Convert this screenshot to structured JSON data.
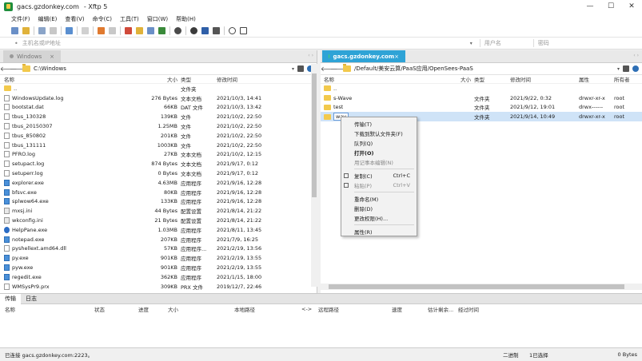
{
  "app": {
    "host": "gacs.gzdonkey.com",
    "title_suffix": "- Xftp 5"
  },
  "window_controls": {
    "minimize": "—",
    "maximize": "☐",
    "close": "✕"
  },
  "menu": [
    "文件(F)",
    "编辑(E)",
    "查看(V)",
    "命令(C)",
    "工具(T)",
    "窗口(W)",
    "帮助(H)"
  ],
  "addressbar": {
    "host_placeholder": "主机名或IP地址",
    "user_placeholder": "用户名",
    "password_placeholder": "密码"
  },
  "left": {
    "tab": "Windows",
    "path": "C:\\Windows",
    "columns": [
      "名称",
      "大小",
      "类型",
      "修改时间"
    ],
    "files": [
      {
        "name": "..",
        "size": "",
        "type": "文件夹",
        "mtime": "",
        "icon": "folder"
      },
      {
        "name": "WindowsUpdate.log",
        "size": "276 Bytes",
        "type": "文本文档",
        "mtime": "2021/10/3, 14:41",
        "icon": "file"
      },
      {
        "name": "bootstat.dat",
        "size": "66KB",
        "type": "DAT 文件",
        "mtime": "2021/10/3, 13:42",
        "icon": "file"
      },
      {
        "name": "tbus_130328",
        "size": "139KB",
        "type": "文件",
        "mtime": "2021/10/2, 22:50",
        "icon": "file"
      },
      {
        "name": "tbus_20150307",
        "size": "1.25MB",
        "type": "文件",
        "mtime": "2021/10/2, 22:50",
        "icon": "file"
      },
      {
        "name": "tbus_850802",
        "size": "201KB",
        "type": "文件",
        "mtime": "2021/10/2, 22:50",
        "icon": "file"
      },
      {
        "name": "tbus_131111",
        "size": "1003KB",
        "type": "文件",
        "mtime": "2021/10/2, 22:50",
        "icon": "file"
      },
      {
        "name": "PFRO.log",
        "size": "27KB",
        "type": "文本文档",
        "mtime": "2021/10/2, 12:15",
        "icon": "file"
      },
      {
        "name": "setupact.log",
        "size": "874 Bytes",
        "type": "文本文档",
        "mtime": "2021/9/17, 0:12",
        "icon": "file"
      },
      {
        "name": "setuperr.log",
        "size": "0 Bytes",
        "type": "文本文档",
        "mtime": "2021/9/17, 0:12",
        "icon": "file"
      },
      {
        "name": "explorer.exe",
        "size": "4.63MB",
        "type": "应用程序",
        "mtime": "2021/9/16, 12:28",
        "icon": "exe"
      },
      {
        "name": "bfsvc.exe",
        "size": "80KB",
        "type": "应用程序",
        "mtime": "2021/9/16, 12:28",
        "icon": "exe"
      },
      {
        "name": "splwow64.exe",
        "size": "133KB",
        "type": "应用程序",
        "mtime": "2021/9/16, 12:28",
        "icon": "exe"
      },
      {
        "name": "mxsj.ini",
        "size": "44 Bytes",
        "type": "配置设置",
        "mtime": "2021/8/14, 21:22",
        "icon": "cfg"
      },
      {
        "name": "wkconfig.ini",
        "size": "21 Bytes",
        "type": "配置设置",
        "mtime": "2021/8/14, 21:22",
        "icon": "cfg"
      },
      {
        "name": "HelpPane.exe",
        "size": "1.03MB",
        "type": "应用程序",
        "mtime": "2021/8/11, 13:45",
        "icon": "help"
      },
      {
        "name": "notepad.exe",
        "size": "207KB",
        "type": "应用程序",
        "mtime": "2021/7/9, 16:25",
        "icon": "exe"
      },
      {
        "name": "pyshellext.amd64.dll",
        "size": "57KB",
        "type": "应用程序...",
        "mtime": "2021/2/19, 13:56",
        "icon": "file"
      },
      {
        "name": "py.exe",
        "size": "901KB",
        "type": "应用程序",
        "mtime": "2021/2/19, 13:55",
        "icon": "exe"
      },
      {
        "name": "pyw.exe",
        "size": "901KB",
        "type": "应用程序",
        "mtime": "2021/2/19, 13:55",
        "icon": "exe"
      },
      {
        "name": "regedit.exe",
        "size": "362KB",
        "type": "应用程序",
        "mtime": "2021/1/15, 18:00",
        "icon": "exe"
      },
      {
        "name": "WMSysPr9.prx",
        "size": "309KB",
        "type": "PRX 文件",
        "mtime": "2019/12/7, 22:46",
        "icon": "file"
      }
    ]
  },
  "right": {
    "tab": "gacs.gzdonkey.com",
    "path": "/Default/美安云算/PaaS应用/OpenSees-PaaS",
    "columns": [
      "名称",
      "大小",
      "类型",
      "修改时间",
      "属性",
      "所有者"
    ],
    "files": [
      {
        "name": "..",
        "size": "",
        "type": "",
        "mtime": "",
        "attr": "",
        "owner": ""
      },
      {
        "name": "s-Wave",
        "size": "",
        "type": "文件夹",
        "mtime": "2021/9/22, 0:32",
        "attr": "drwxr-xr-x",
        "owner": "root"
      },
      {
        "name": "test",
        "size": "",
        "type": "文件夹",
        "mtime": "2021/9/12, 19:01",
        "attr": "drwx------",
        "owner": "root"
      },
      {
        "name": "wav",
        "size": "",
        "type": "文件夹",
        "mtime": "2021/9/14, 10:49",
        "attr": "drwxr-xr-x",
        "owner": "root"
      }
    ]
  },
  "context_menu": [
    {
      "label": "传输(T)",
      "shortcut": "",
      "disabled": false,
      "bold": false
    },
    {
      "label": "下载到默认文件夹(F)",
      "shortcut": "",
      "disabled": false,
      "bold": false
    },
    {
      "label": "队列(Q)",
      "shortcut": "",
      "disabled": false,
      "bold": false
    },
    {
      "label": "打开(O)",
      "shortcut": "",
      "disabled": false,
      "bold": true
    },
    {
      "label": "用记事本编辑(N)",
      "shortcut": "",
      "disabled": true,
      "bold": false
    },
    {
      "sep": true
    },
    {
      "label": "复制(C)",
      "shortcut": "Ctrl+C",
      "disabled": false,
      "bold": false,
      "icon": true
    },
    {
      "label": "粘贴(P)",
      "shortcut": "Ctrl+V",
      "disabled": true,
      "bold": false,
      "icon": true
    },
    {
      "sep": true
    },
    {
      "label": "重命名(M)",
      "shortcut": "",
      "disabled": false,
      "bold": false
    },
    {
      "label": "删除(D)",
      "shortcut": "",
      "disabled": false,
      "bold": false
    },
    {
      "label": "更改权限(H)...",
      "shortcut": "",
      "disabled": false,
      "bold": false
    },
    {
      "sep": true
    },
    {
      "label": "属性(R)",
      "shortcut": "",
      "disabled": false,
      "bold": false
    }
  ],
  "transfer": {
    "tabs": [
      "传输",
      "日志"
    ],
    "columns": [
      "名称",
      "状态",
      "进度",
      "大小",
      "本地路径",
      "<->",
      "远程路径",
      "速度",
      "估计剩余...",
      "经过时间"
    ]
  },
  "status": {
    "left": "已连接 gacs.gzdonkey.com:2223。",
    "encoding": "二进制",
    "selected": "1已选择",
    "size": "0 Bytes"
  },
  "colors": {
    "accent_tab": "#2ea3d6",
    "folder": "#f2c94c",
    "selection": "#cfe3f7"
  }
}
